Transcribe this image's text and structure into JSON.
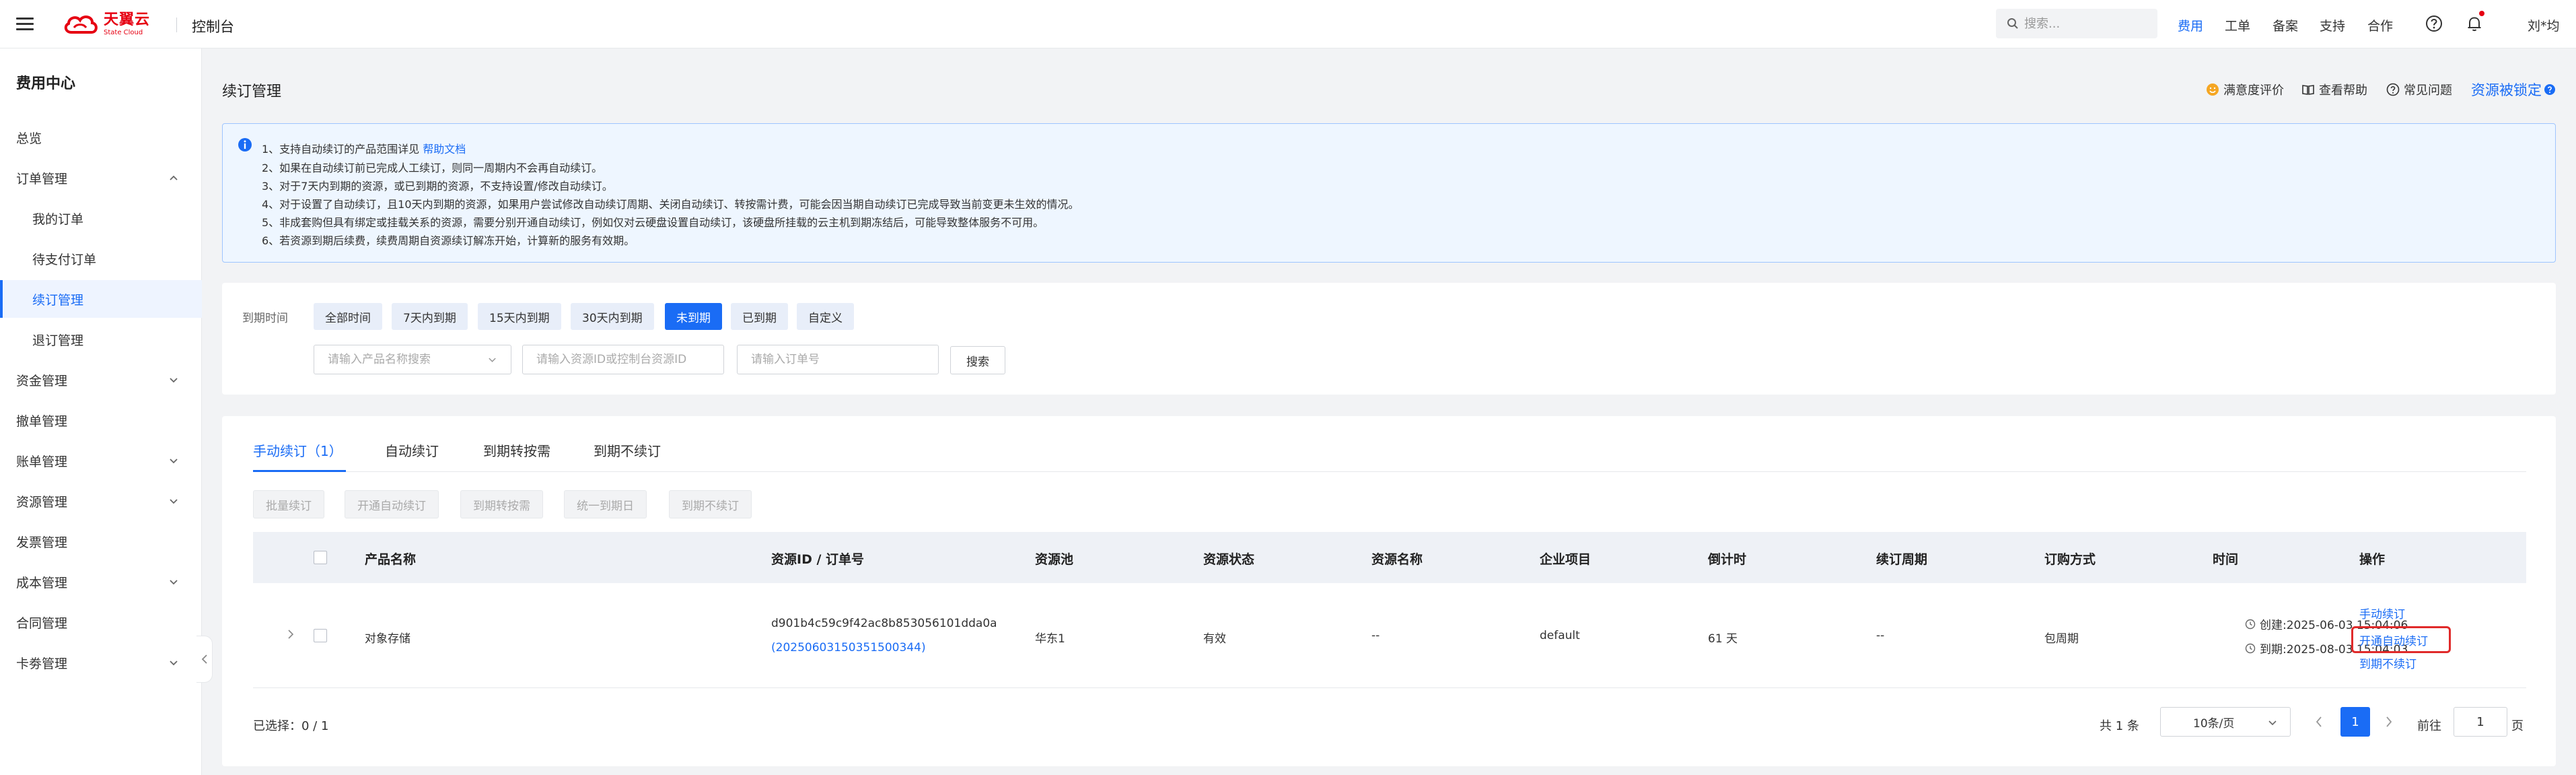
{
  "header": {
    "logo": {
      "cn": "天翼云",
      "en": "State Cloud"
    },
    "console_title": "控制台",
    "search_placeholder": "搜索...",
    "nav": [
      "费用",
      "工单",
      "备案",
      "支持",
      "合作"
    ],
    "active_nav": "费用",
    "user": "刘*均",
    "accent_color": "#1a6cf5",
    "icons": [
      "menu-icon",
      "search-icon",
      "help-icon",
      "bell-icon"
    ]
  },
  "sidebar": {
    "title": "费用中心",
    "items": [
      {
        "label": "总览"
      },
      {
        "label": "订单管理"
      },
      {
        "label": "我的订单"
      },
      {
        "label": "待支付订单"
      },
      {
        "label": "续订管理"
      },
      {
        "label": "退订管理"
      },
      {
        "label": "资金管理"
      },
      {
        "label": "撤单管理"
      },
      {
        "label": "账单管理"
      },
      {
        "label": "资源管理"
      },
      {
        "label": "发票管理"
      },
      {
        "label": "成本管理"
      },
      {
        "label": "合同管理"
      },
      {
        "label": "卡劵管理"
      }
    ],
    "active_item": "续订管理"
  },
  "page": {
    "title": "续订管理",
    "links": {
      "satisfaction": "满意度评价",
      "help": "查看帮助",
      "faq": "常见问题",
      "lock": "资源被锁定"
    }
  },
  "notice": {
    "lines": [
      {
        "text": "1、支持自动续订的产品范围详见 ",
        "link": "帮助文档"
      },
      {
        "text": "2、如果在自动续订前已完成人工续订，则同一周期内不会再自动续订。"
      },
      {
        "text": "3、对于7天内到期的资源，或已到期的资源，不支持设置/修改自动续订。"
      },
      {
        "text": "4、对于设置了自动续订，且10天内到期的资源，如果用户尝试修改自动续订周期、关闭自动续订、转按需计费，可能会因当期自动续订已完成导致当前变更未生效的情况。"
      },
      {
        "text": "5、非成套购但具有绑定或挂载关系的资源，需要分别开通自动续订，例如仅对云硬盘设置自动续订，该硬盘所挂载的云主机到期冻结后，可能导致整体服务不可用。"
      },
      {
        "text": "6、若资源到期后续费，续费周期自资源续订解冻开始，计算新的服务有效期。"
      }
    ]
  },
  "filters": {
    "label": "到期时间",
    "time_options": [
      "全部时间",
      "7天内到期",
      "15天内到期",
      "30天内到期",
      "未到期",
      "已到期",
      "自定义"
    ],
    "active_option": "未到期",
    "product_placeholder": "请输入产品名称搜索",
    "resource_placeholder": "请输入资源ID或控制台资源ID",
    "order_placeholder": "请输入订单号",
    "search_label": "搜索"
  },
  "tabs": {
    "items": [
      "手动续订（1）",
      "自动续订",
      "到期转按需",
      "到期不续订"
    ],
    "active": "手动续订（1）"
  },
  "bulk_actions": [
    "批量续订",
    "开通自动续订",
    "到期转按需",
    "统一到期日",
    "到期不续订"
  ],
  "table": {
    "columns": [
      "产品名称",
      "资源ID / 订单号",
      "资源池",
      "资源状态",
      "资源名称",
      "企业项目",
      "倒计时",
      "续订周期",
      "订购方式",
      "时间",
      "操作"
    ],
    "rows": [
      {
        "product": "对象存储",
        "resource_id": "d901b4c59c9f42ac8b853056101dda0a",
        "order_no": "(20250603150351500344)",
        "pool": "华东1",
        "status": "有效",
        "name": "--",
        "project": "default",
        "countdown": "61 天",
        "period": "--",
        "method": "包周期",
        "created": "创建:2025-06-03 15:04:06",
        "expires": "到期:2025-08-03 15:04:03",
        "actions": [
          "手动续订",
          "开通自动续订",
          "到期不续订"
        ]
      }
    ]
  },
  "footer": {
    "selected": "已选择：0 / 1",
    "total": "共 1 条",
    "page_size": "10条/页",
    "current_page": "1",
    "goto_label": "前往",
    "goto_value": "1",
    "goto_suffix": "页"
  }
}
